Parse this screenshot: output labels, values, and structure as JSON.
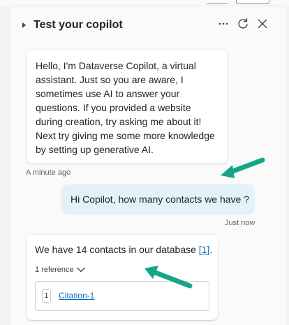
{
  "header": {
    "title": "Test your copilot",
    "more_icon": "more-horizontal-icon",
    "refresh_icon": "refresh-icon",
    "close_icon": "close-icon",
    "collapse_icon": "caret-right-icon"
  },
  "messages": [
    {
      "role": "bot",
      "lines": [
        "Hello, I'm Dataverse Copilot, a virtual",
        "assistant. Just so you are aware, I",
        "sometimes use AI to answer your",
        "questions. If you provided a website",
        "during creation, try asking me about it!",
        "Next try giving me some more knowledge",
        "by setting up generative AI."
      ],
      "timestamp": "A minute ago"
    },
    {
      "role": "user",
      "text": "Hi Copilot, how many contacts we have ?",
      "timestamp": "Just now"
    },
    {
      "role": "bot",
      "text": "We have 14 contacts in our database",
      "citation_ref": "[1]",
      "citation_suffix": ".",
      "references_label": "1 reference",
      "citations": [
        {
          "number": "1",
          "label": "Citation-1"
        }
      ]
    }
  ],
  "annotations": {
    "arrow_color": "#17a589"
  },
  "colors": {
    "user_bubble": "#e3f1fb",
    "link": "#0f6cbd",
    "panel": "#fafafa"
  }
}
